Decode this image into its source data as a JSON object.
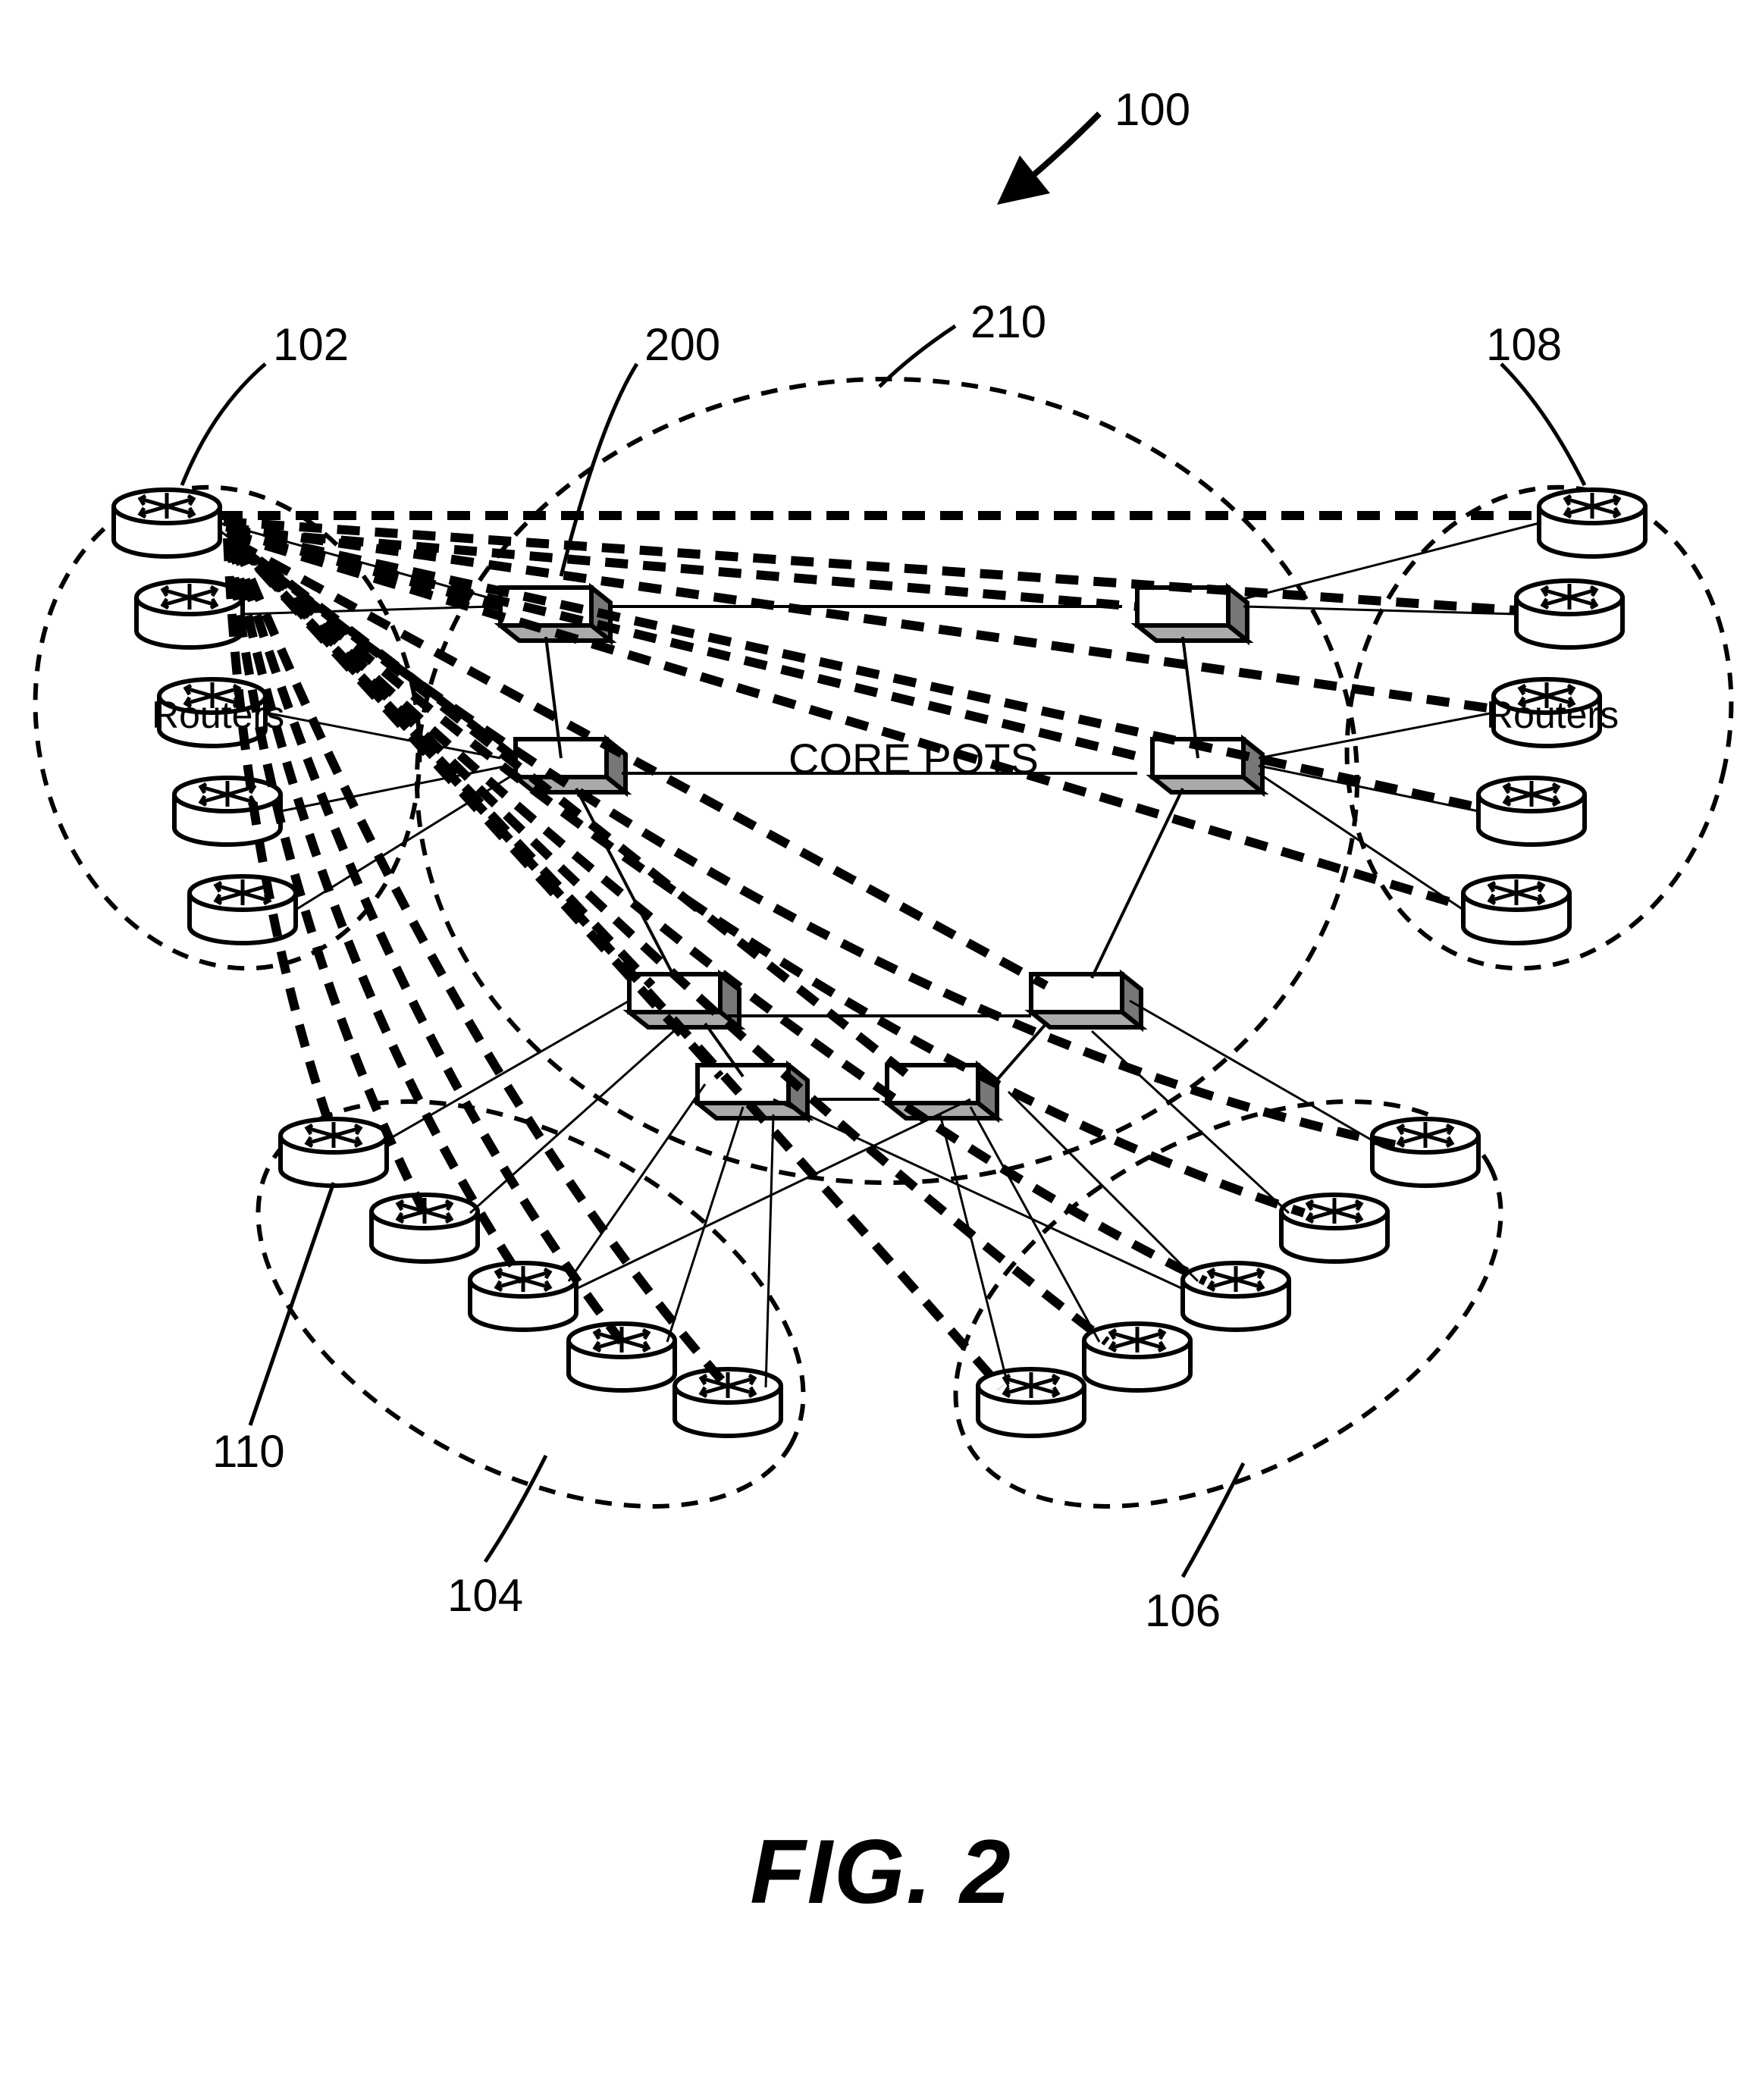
{
  "figure": {
    "caption": "FIG. 2",
    "reference_100": "100",
    "reference_102": "102",
    "reference_104": "104",
    "reference_106": "106",
    "reference_108": "108",
    "reference_110": "110",
    "reference_200": "200",
    "reference_210": "210",
    "core_label": "CORE POTS",
    "routers_left": "Routers",
    "routers_right": "Routers"
  }
}
